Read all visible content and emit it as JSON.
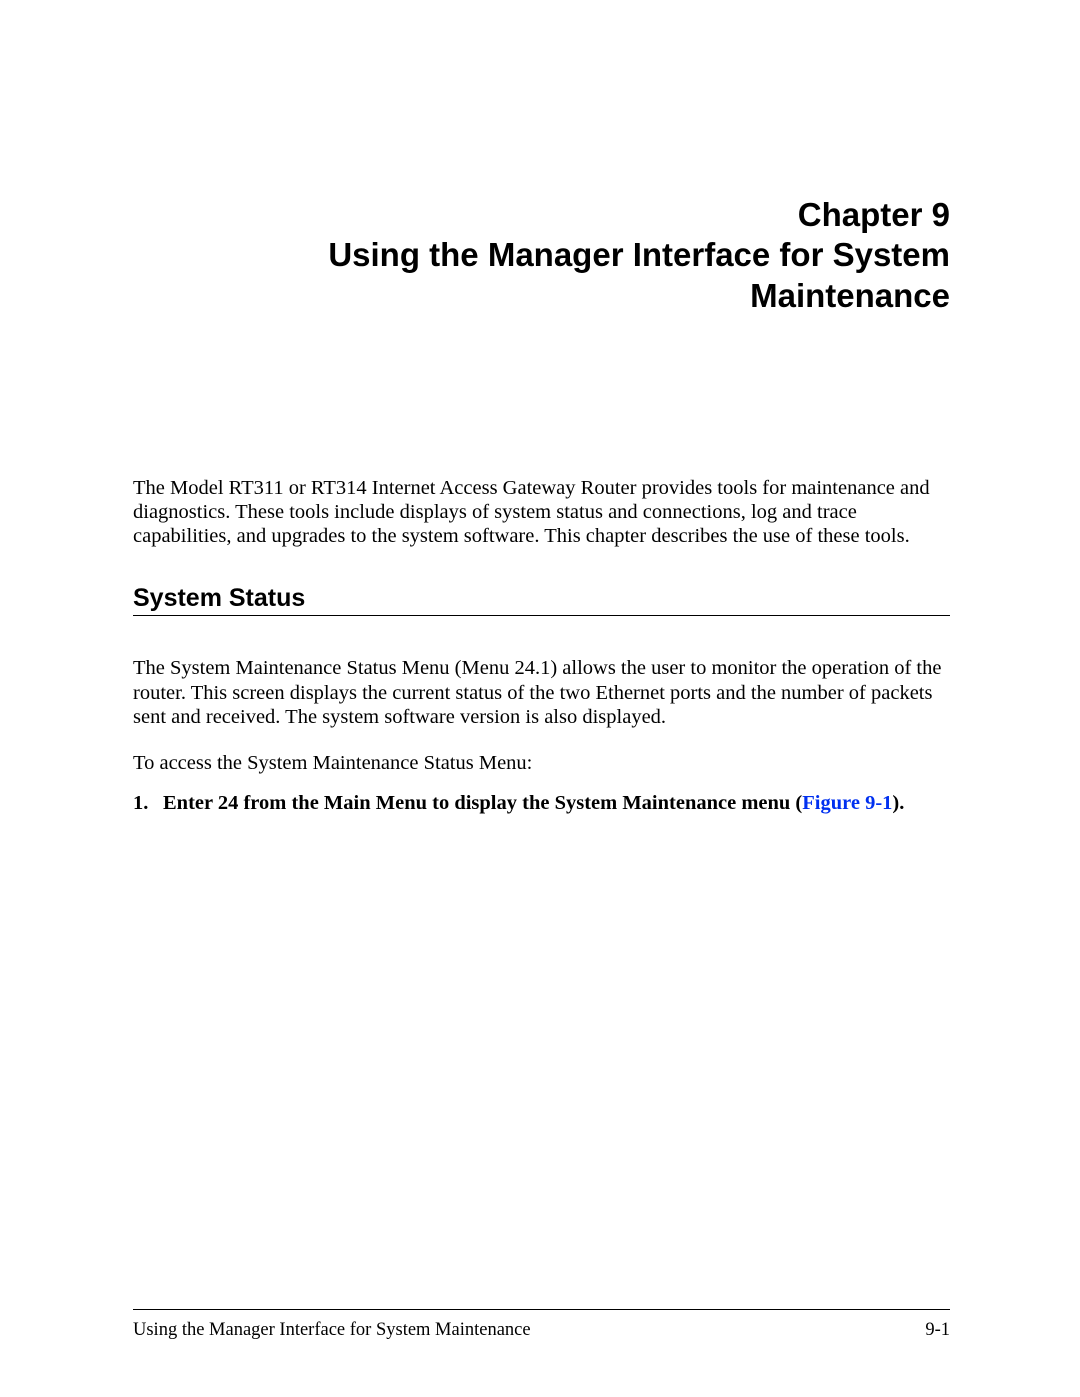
{
  "chapter": {
    "number": "Chapter 9",
    "title_line1": "Using the Manager Interface for System",
    "title_line2": "Maintenance"
  },
  "intro": "The Model RT311 or RT314 Internet Access Gateway Router provides tools for maintenance and diagnostics. These tools include displays of system status and connections, log and trace capabilities, and upgrades to the system software. This chapter describes the use of these tools.",
  "section_heading": "System Status",
  "section_body": "The System Maintenance Status Menu (Menu 24.1) allows the user to monitor the operation of the router. This screen displays the current status of the two Ethernet ports and the number of packets sent and received. The system software version is also displayed.",
  "access_line": "To access the System Maintenance Status Menu:",
  "step": {
    "number": "1.",
    "text_before": "Enter 24 from the Main Menu to display the System Maintenance menu (",
    "figure_link": "Figure 9-1",
    "text_after": ")."
  },
  "footer": {
    "title": "Using the Manager Interface for System Maintenance",
    "page": "9-1"
  }
}
